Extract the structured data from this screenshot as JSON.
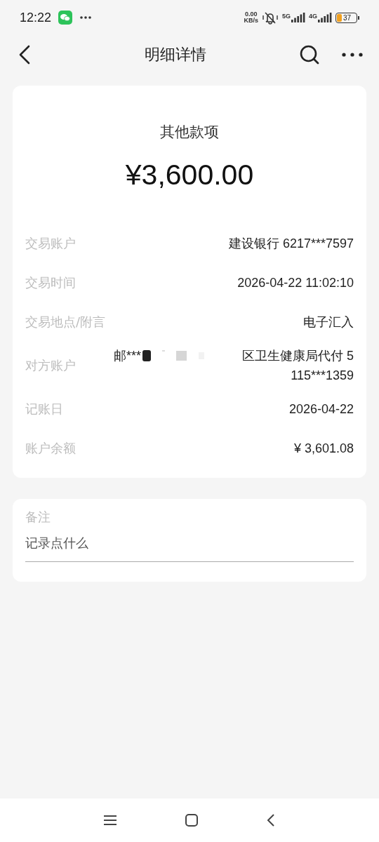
{
  "status_bar": {
    "time": "12:22",
    "net_speed": "0.00",
    "net_unit": "KB/s",
    "sim1": "5G",
    "sim2": "4G",
    "battery": "37"
  },
  "header": {
    "title": "明细详情"
  },
  "summary": {
    "category": "其他款项",
    "amount": "¥3,600.00"
  },
  "details": [
    {
      "label": "交易账户",
      "value": "建设银行 6217***7597"
    },
    {
      "label": "交易时间",
      "value": "2026-04-22 11:02:10"
    },
    {
      "label": "交易地点/附言",
      "value": "电子汇入"
    },
    {
      "label": "对方账户",
      "value_start": "邮***",
      "redacted": true,
      "value_end": "区卫生健康局代付 5",
      "value_continued": "115***1359"
    },
    {
      "label": "记账日",
      "value": "2026-04-22"
    },
    {
      "label": "账户余额",
      "value": "¥ 3,601.08"
    }
  ],
  "memo": {
    "label": "备注",
    "placeholder": "记录点什么"
  }
}
